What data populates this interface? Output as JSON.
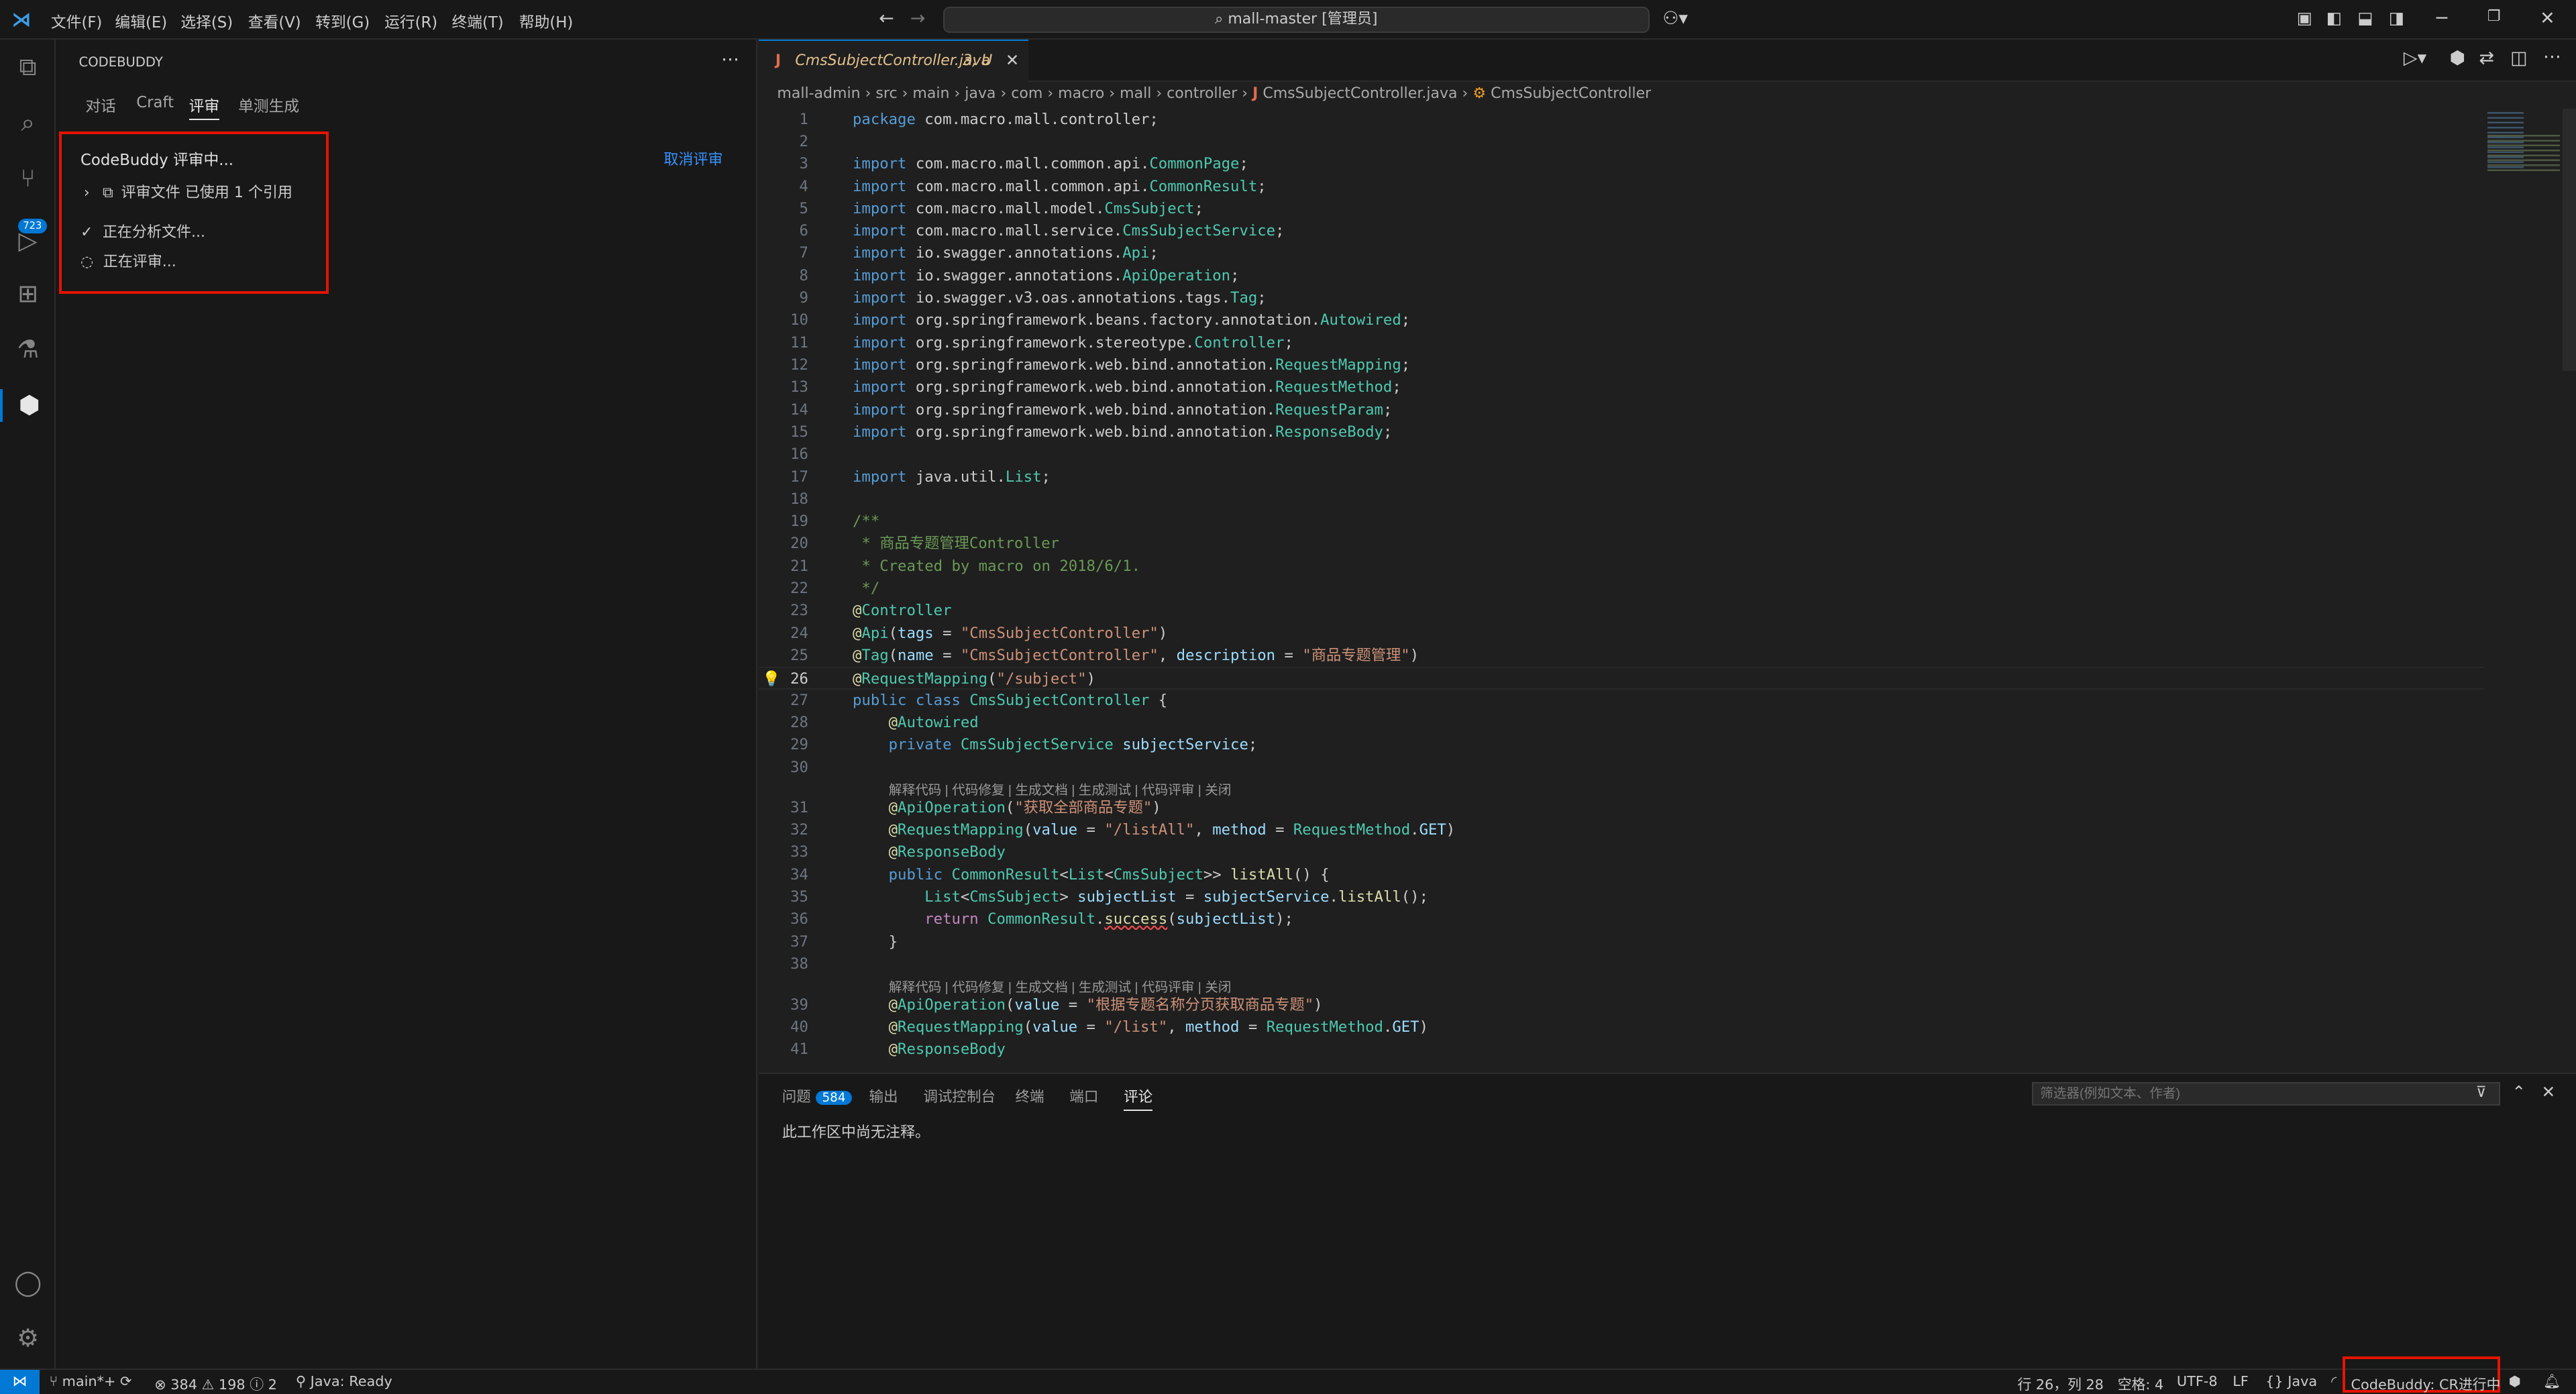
{
  "menu": [
    "文件(F)",
    "编辑(E)",
    "选择(S)",
    "查看(V)",
    "转到(G)",
    "运行(R)",
    "终端(T)",
    "帮助(H)"
  ],
  "command_center": "mall-master [管理员]",
  "activity": {
    "scm_badge": "723"
  },
  "sidebar": {
    "title": "CODEBUDDY",
    "tabs": [
      "对话",
      "Craft",
      "评审",
      "单测生成"
    ],
    "reviewing": "CodeBuddy 评审中...",
    "cancel": "取消评审",
    "files_row": "评审文件 已使用 1 个引用",
    "analyzing": "正在分析文件...",
    "reviewing_step": "正在评审..."
  },
  "editor": {
    "tab_name": "CmsSubjectController.java",
    "tab_status": "3, U",
    "breadcrumbs": [
      "mall-admin",
      "src",
      "main",
      "java",
      "com",
      "macro",
      "mall",
      "controller",
      "CmsSubjectController.java",
      "CmsSubjectController"
    ],
    "lens": "解释代码 | 代码修复 | 生成文档 | 生成测试 | 代码评审 | 关闭"
  },
  "panel": {
    "tabs": [
      "问题",
      "输出",
      "调试控制台",
      "终端",
      "端口",
      "评论"
    ],
    "problems_count": "584",
    "filter_placeholder": "筛选器(例如文本、作者)",
    "message": "此工作区中尚无注释。"
  },
  "status": {
    "branch": "main*+",
    "errors": "384",
    "warnings": "198",
    "infos": "2",
    "java": "Java: Ready",
    "position": "行 26，列 28",
    "spaces": "空格: 4",
    "encoding": "UTF-8",
    "eol": "LF",
    "language": "Java",
    "codebuddy": "CodeBuddy: CR进行中"
  }
}
